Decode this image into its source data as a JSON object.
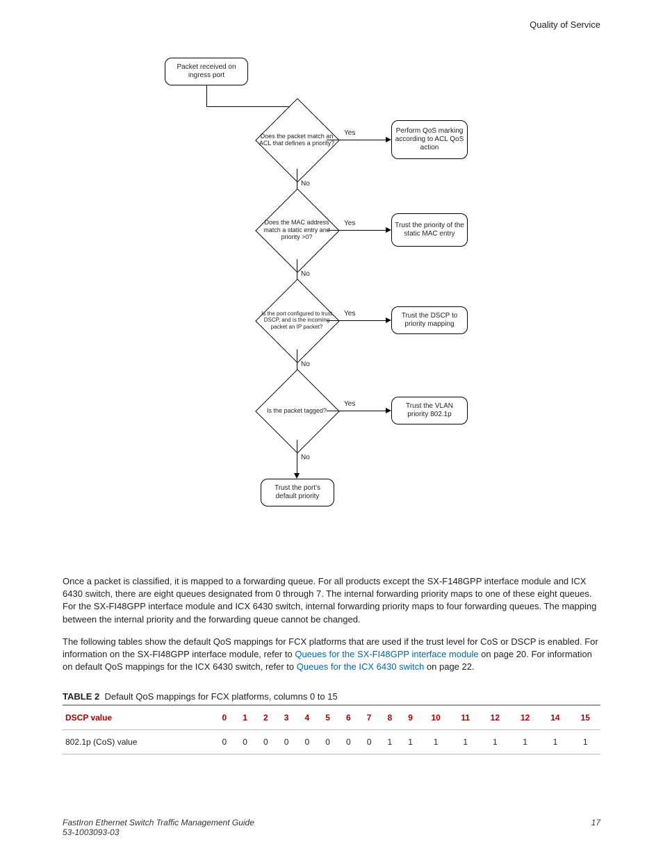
{
  "header": {
    "title": "Quality of Service"
  },
  "flowchart": {
    "start": "Packet received on ingress port",
    "d1": "Does the packet match an ACL that defines a priority?",
    "a1": "Perform QoS marking according to ACL QoS action",
    "d2": "Does the MAC address match a static entry and priority >0?",
    "a2": "Trust the priority of the static MAC entry",
    "d3": "Is the port configured to trust DSCP, and is the incoming packet an IP packet?",
    "a3": "Trust the DSCP to priority mapping",
    "d4": "Is the packet tagged?",
    "a4": "Trust the VLAN priority 802.1p",
    "end": "Trust the port's default priority",
    "yes": "Yes",
    "no": "No"
  },
  "para1": "Once a packet is classified, it is mapped to a forwarding queue. For all products except the SX-F148GPP interface module and ICX 6430 switch, there are eight queues designated from 0 through 7. The internal forwarding priority maps to one of these eight queues. For the SX-FI48GPP interface module and ICX 6430 switch, internal forwarding priority maps to four forwarding queues. The mapping between the internal priority and the forwarding queue cannot be changed.",
  "para2a": "The following tables show the default QoS mappings for FCX platforms that are used if the trust level for CoS or DSCP is enabled. For information on the SX-FI48GPP interface module, refer to ",
  "link1": "Queues for the SX-FI48GPP interface module",
  "para2b": " on page 20. For information on default QoS mappings for the ICX 6430 switch, refer to ",
  "link2": "Queues for the ICX 6430 switch",
  "para2c": " on page 22.",
  "table": {
    "label": "TABLE 2",
    "title": "Default QoS mappings for FCX platforms, columns 0 to 15",
    "row1label": "DSCP value",
    "row2label": "802.1p (CoS) value",
    "headers": [
      "0",
      "1",
      "2",
      "3",
      "4",
      "5",
      "6",
      "7",
      "8",
      "9",
      "10",
      "11",
      "12",
      "12",
      "14",
      "15"
    ],
    "values": [
      "0",
      "0",
      "0",
      "0",
      "0",
      "0",
      "0",
      "0",
      "1",
      "1",
      "1",
      "1",
      "1",
      "1",
      "1",
      "1"
    ]
  },
  "footer": {
    "left1": "FastIron Ethernet Switch Traffic Management Guide",
    "left2": "53-1003093-03",
    "right": "17"
  },
  "chart_data": {
    "type": "table",
    "title": "Default QoS mappings for FCX platforms, columns 0 to 15",
    "categories": [
      "0",
      "1",
      "2",
      "3",
      "4",
      "5",
      "6",
      "7",
      "8",
      "9",
      "10",
      "11",
      "12",
      "12",
      "14",
      "15"
    ],
    "series": [
      {
        "name": "DSCP value",
        "values": [
          0,
          1,
          2,
          3,
          4,
          5,
          6,
          7,
          8,
          9,
          10,
          11,
          12,
          12,
          14,
          15
        ]
      },
      {
        "name": "802.1p (CoS) value",
        "values": [
          0,
          0,
          0,
          0,
          0,
          0,
          0,
          0,
          1,
          1,
          1,
          1,
          1,
          1,
          1,
          1
        ]
      }
    ]
  }
}
